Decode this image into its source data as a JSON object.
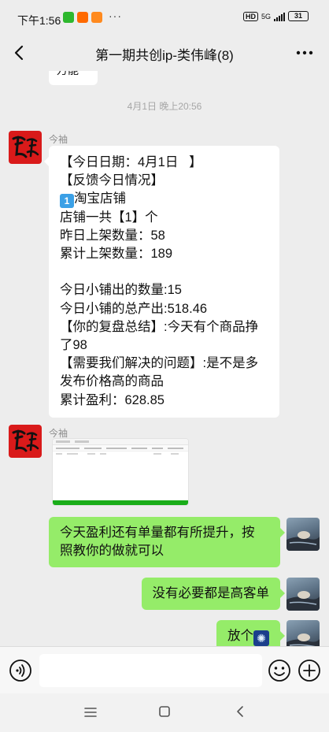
{
  "status_bar": {
    "time": "下午1:56",
    "dots": "···",
    "hd": "HD",
    "network": "5G",
    "battery": "31"
  },
  "header": {
    "title": "第一期共创ip-类伟峰(8)"
  },
  "chat": {
    "partial_text": "万能",
    "timestamp": "4月1日 晚上20:56",
    "messages": [
      {
        "sender": "今袖",
        "lines": [
          "【今日日期：4月1日   】",
          "【反馈今日情况】",
          "淘宝店铺",
          "店铺一共【1】个",
          "昨日上架数量：58",
          "累计上架数量：189",
          " ",
          "今日小铺出的数量:15",
          "今日小铺的总产出:518.46",
          "【你的复盘总结】:今天有个商品挣",
          "了98",
          "【需要我们解决的问题】:是不是多",
          "发布价格高的商品",
          "累计盈利：628.85"
        ],
        "keycap": "1"
      },
      {
        "sender": "今袖"
      },
      {
        "lines": [
          "今天盈利还有单量都有所提升，按",
          "照教你的做就可以"
        ]
      },
      {
        "lines": [
          "没有必要都是高客单"
        ]
      },
      {
        "text": "放个",
        "emoji": "fireworks-icon"
      }
    ]
  },
  "input_bar": {
    "placeholder": ""
  },
  "colors": {
    "background": "#ededed",
    "own_bubble": "#95ec69",
    "other_bubble": "#ffffff",
    "avatar_red": "#d91a1a"
  }
}
